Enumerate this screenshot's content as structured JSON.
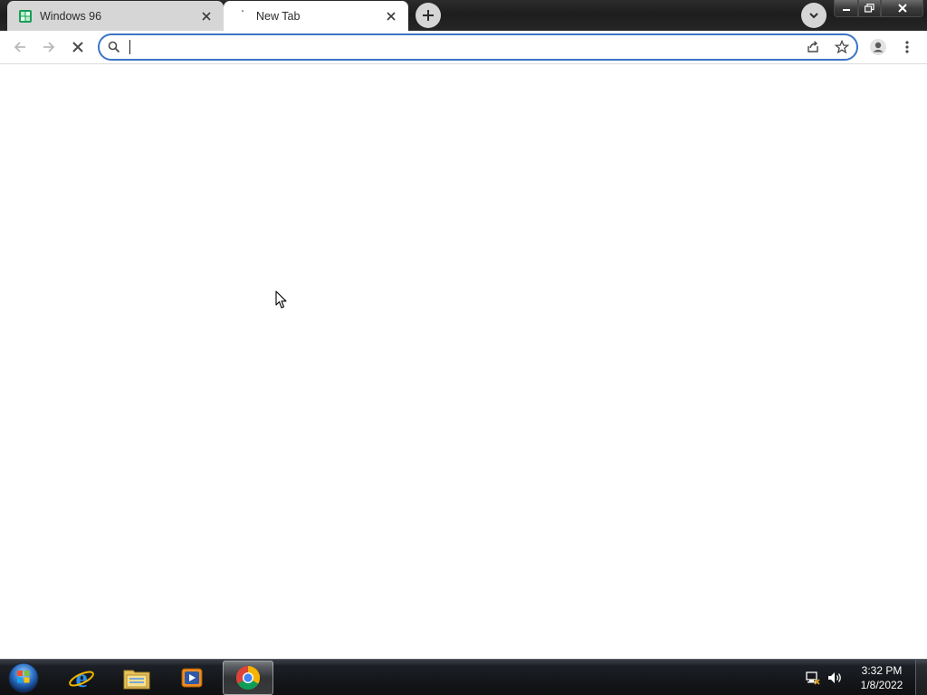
{
  "browser": {
    "tabs": [
      {
        "title": "Windows 96",
        "favicon": "windows96-icon",
        "active": false
      },
      {
        "title": "New Tab",
        "favicon": "loading-spinner-icon",
        "active": true
      }
    ],
    "new_tab_icon": "plus-icon",
    "tab_search_icon": "chevron-down-icon",
    "window_controls": [
      "minimize-icon",
      "restore-icon",
      "close-icon"
    ]
  },
  "toolbar": {
    "back_icon": "arrow-left-icon",
    "forward_icon": "arrow-right-icon",
    "stop_icon": "stop-icon",
    "omnibox": {
      "value": "",
      "placeholder": ""
    },
    "share_icon": "share-icon",
    "bookmark_icon": "star-icon",
    "profile_icon": "profile-icon",
    "menu_icon": "kebab-menu-icon",
    "accent": "#3b74c6"
  },
  "taskbar": {
    "start_icon": "windows-start-orb-icon",
    "apps": [
      {
        "name": "internet-explorer-icon",
        "active": false
      },
      {
        "name": "file-explorer-icon",
        "active": false
      },
      {
        "name": "media-player-icon",
        "active": false
      },
      {
        "name": "chrome-icon",
        "active": true
      }
    ],
    "tray": [
      "network-icon",
      "volume-icon"
    ],
    "clock": {
      "time": "3:32 PM",
      "date": "1/8/2022"
    }
  }
}
